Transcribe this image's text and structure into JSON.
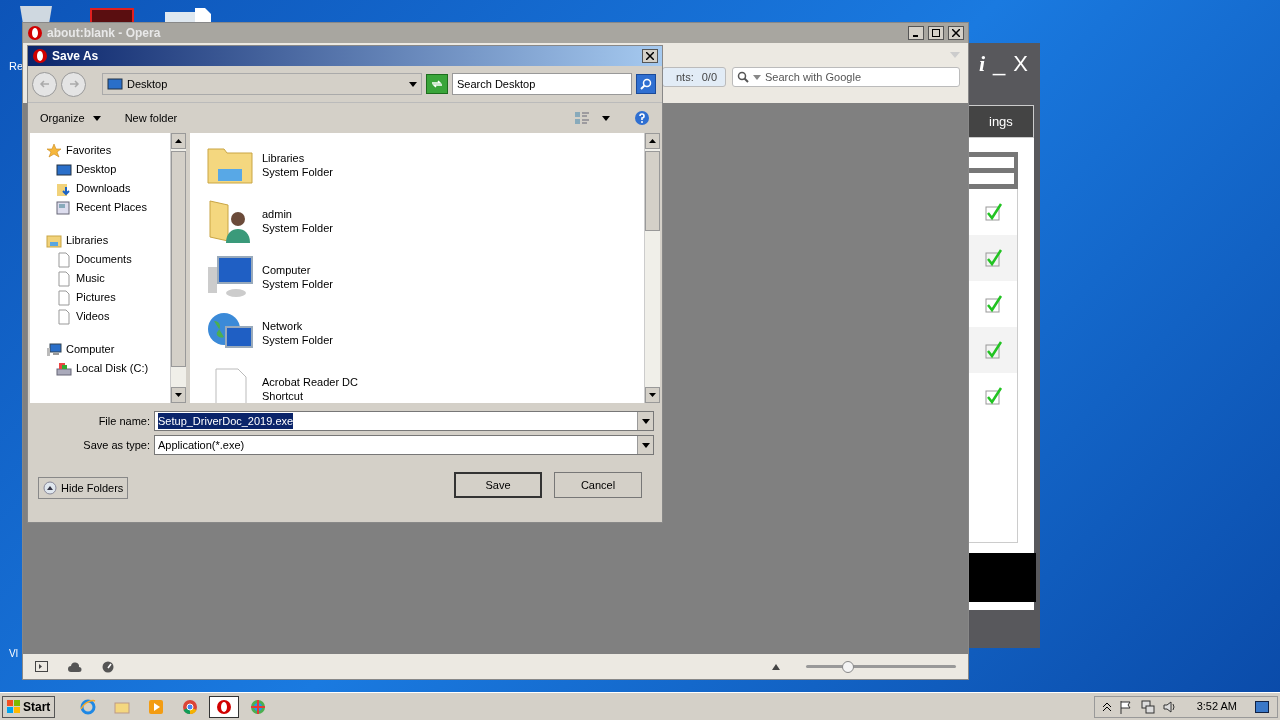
{
  "desktop": {
    "icon_labels": [
      "Re",
      "Vl"
    ]
  },
  "background_app": {
    "title_buttons": [
      "i",
      "_",
      "X"
    ],
    "tab": "ings",
    "rows": [
      {
        "checked": true
      },
      {
        "checked": true
      },
      {
        "checked": true
      },
      {
        "checked": true
      },
      {
        "checked": true
      }
    ]
  },
  "browser": {
    "title": "about:blank - Opera",
    "counter_label": "nts:",
    "counter_value": "0/0",
    "search": {
      "placeholder": "Search with Google"
    },
    "zoom_slider": {
      "level": 0.28
    }
  },
  "dialog": {
    "title": "Save As",
    "address": "Desktop",
    "search": {
      "placeholder": "Search Desktop"
    },
    "toolbar": [
      "Organize",
      "New folder"
    ],
    "nav": [
      {
        "label": "Favorites",
        "kind": "star",
        "children": [
          {
            "label": "Desktop",
            "kind": "desktop"
          },
          {
            "label": "Downloads",
            "kind": "downloads"
          },
          {
            "label": "Recent Places",
            "kind": "recent"
          }
        ]
      },
      {
        "label": "Libraries",
        "kind": "library",
        "children": [
          {
            "label": "Documents",
            "kind": "doc"
          },
          {
            "label": "Music",
            "kind": "doc"
          },
          {
            "label": "Pictures",
            "kind": "doc"
          },
          {
            "label": "Videos",
            "kind": "doc"
          }
        ]
      },
      {
        "label": "Computer",
        "kind": "computer",
        "children": [
          {
            "label": "Local Disk (C:)",
            "kind": "disk"
          }
        ]
      }
    ],
    "files": [
      {
        "name": "Libraries",
        "type": "System Folder",
        "kind": "library"
      },
      {
        "name": "admin",
        "type": "System Folder",
        "kind": "user"
      },
      {
        "name": "Computer",
        "type": "System Folder",
        "kind": "computer"
      },
      {
        "name": "Network",
        "type": "System Folder",
        "kind": "network"
      },
      {
        "name": "Acrobat Reader DC",
        "type": "Shortcut",
        "kind": "file"
      }
    ],
    "file_name_label": "File name:",
    "file_name": "Setup_DriverDoc_2019.exe",
    "file_name_selected": true,
    "type_label": "Save as type:",
    "save_as_type": "Application(*.exe)",
    "hide_folders": "Hide Folders",
    "buttons": [
      "Save",
      "Cancel"
    ]
  },
  "taskbar": {
    "start": "Start",
    "apps": [
      {
        "kind": "ie",
        "selected": false
      },
      {
        "kind": "explorer",
        "selected": false
      },
      {
        "kind": "media",
        "selected": false
      },
      {
        "kind": "chrome",
        "selected": false
      },
      {
        "kind": "opera",
        "selected": true
      },
      {
        "kind": "tool",
        "selected": false
      }
    ],
    "clock": "3:52 AM"
  }
}
